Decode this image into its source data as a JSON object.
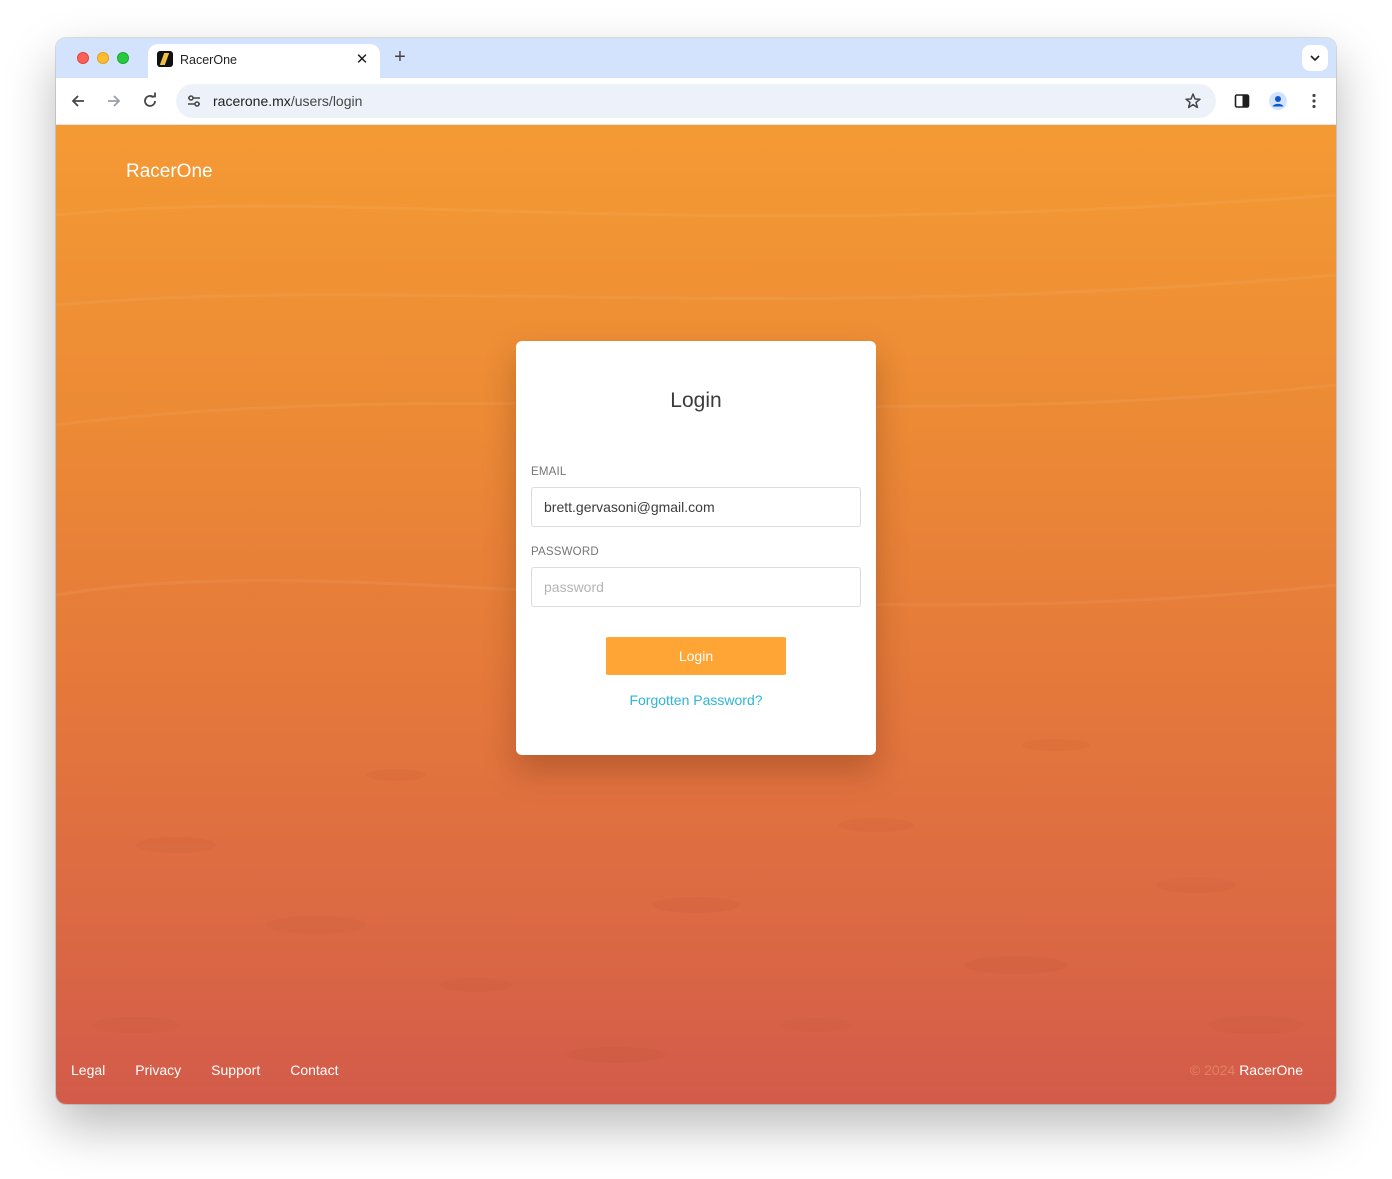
{
  "browser": {
    "tab": {
      "title": "RacerOne",
      "close_icon": "✕"
    },
    "new_tab_icon": "+",
    "url": {
      "host": "racerone.mx",
      "path": "/users/login"
    }
  },
  "page": {
    "brand": "RacerOne",
    "login_card": {
      "title": "Login",
      "email_label": "EMAIL",
      "email_value": "brett.gervasoni@gmail.com",
      "password_label": "PASSWORD",
      "password_placeholder": "password",
      "login_button": "Login",
      "forgot_link": "Forgotten Password?"
    },
    "footer": {
      "links": [
        "Legal",
        "Privacy",
        "Support",
        "Contact"
      ],
      "copyright_year": "© 2024",
      "copyright_name": "RacerOne"
    }
  },
  "colors": {
    "accent_orange": "#ffa535",
    "link_cyan": "#2bb5d6",
    "tabstrip": "#d3e3fd"
  },
  "icons": [
    "back-arrow-icon",
    "forward-arrow-icon",
    "reload-icon",
    "site-settings-icon",
    "bookmark-star-icon",
    "side-panel-icon",
    "profile-icon",
    "more-menu-icon",
    "tab-search-icon"
  ]
}
